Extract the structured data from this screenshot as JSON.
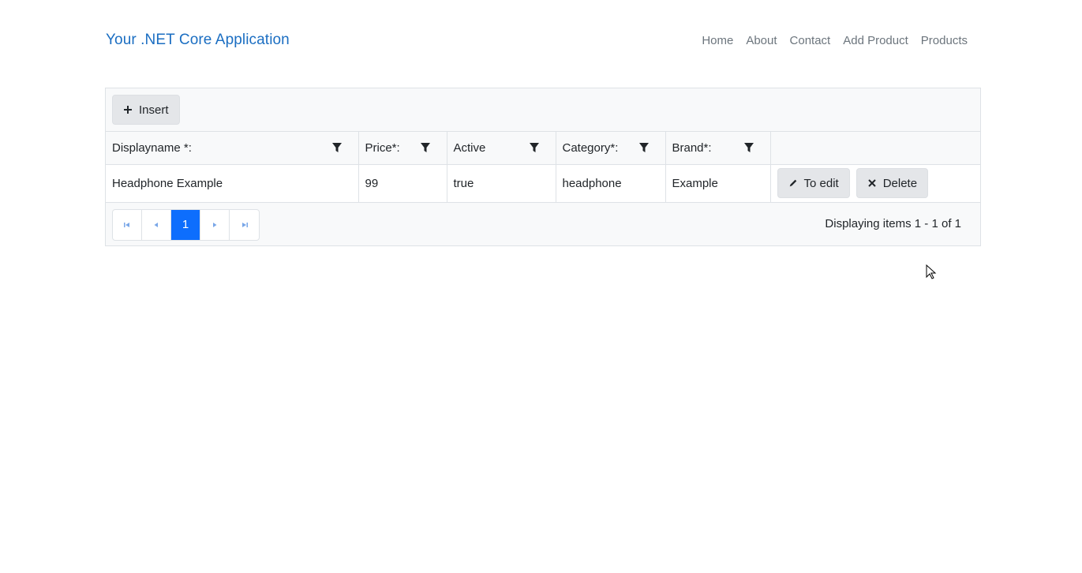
{
  "header": {
    "brand": "Your .NET Core Application",
    "nav": [
      "Home",
      "About",
      "Contact",
      "Add Product",
      "Products"
    ]
  },
  "toolbar": {
    "insert_label": "Insert"
  },
  "table": {
    "columns": [
      "Displayname *:",
      "Price*:",
      "Active",
      "Category*:",
      "Brand*:"
    ],
    "rows": [
      [
        "Headphone Example",
        "99",
        "true",
        "headphone",
        "Example"
      ]
    ],
    "edit_label": "To edit",
    "delete_label": "Delete"
  },
  "pager": {
    "current_page": "1",
    "summary": "Displaying items 1 - 1 of 1"
  },
  "colors": {
    "brand": "#1b6ec2",
    "active_page": "#0d6efd"
  }
}
